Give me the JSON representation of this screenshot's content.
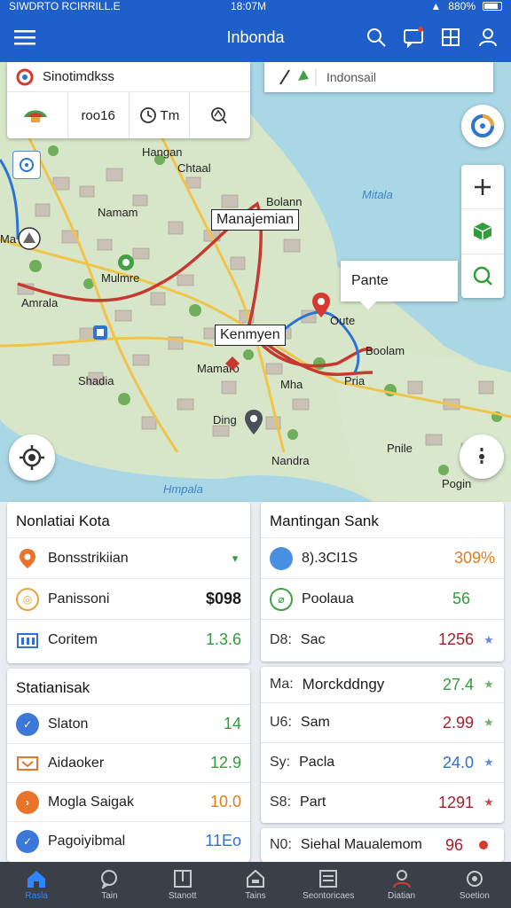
{
  "status_bar": {
    "left": "SIWDRTO RCIRRILL.E",
    "time": "18:07M",
    "battery": "880%"
  },
  "app_bar": {
    "title": "Inbonda"
  },
  "map": {
    "search": {
      "text": "Sinotimdkss",
      "chips": [
        "",
        "roo16",
        "Tm",
        ""
      ]
    },
    "destination": {
      "text": "Indonsail"
    },
    "labels": {
      "hangan": "Hangan",
      "chtaal": "Chtaal",
      "namam": "Namam",
      "mitala": "Mitala",
      "manajemian": "Manajemian",
      "bolann": "Bolann",
      "mulmre": "Mulmre",
      "amrala": "Amrala",
      "kenmyen": "Kenmyen",
      "oute": "Oute",
      "boolam": "Boolam",
      "shadia": "Shadia",
      "mamaro": "Mamaro",
      "mha": "Mha",
      "pria": "Pria",
      "ding": "Ding",
      "nandra": "Nandra",
      "pnile": "Pnile",
      "hmpala": "Hmpala",
      "pogin": "Pogin",
      "ma": "Ma"
    },
    "route_popup": "Pante"
  },
  "panels": {
    "left_top": {
      "title": "Nonlatiai Kota",
      "rows": [
        {
          "icon": "pin-icon",
          "color": "#e8732a",
          "label": "Bonsstrikiian",
          "value": "",
          "tail": "▾"
        },
        {
          "icon": "coin-icon",
          "color": "#e8a33b",
          "label": "Panissoni",
          "value": "$098",
          "tail": ""
        },
        {
          "icon": "building-icon",
          "color": "#2f6fd6",
          "label": "Coritem",
          "value": "1.3.6",
          "tail": ""
        }
      ]
    },
    "left_bottom": {
      "title": "Statianisak",
      "rows": [
        {
          "icon": "check-icon",
          "color": "#3b78d8",
          "label": "Slaton",
          "value": "14",
          "tail": ""
        },
        {
          "icon": "train-icon",
          "color": "#e8732a",
          "label": "Aidaoker",
          "value": "12.9",
          "tail": ""
        },
        {
          "icon": "chevron-icon",
          "color": "#e8732a",
          "label": "Mogla Saigak",
          "value": "10.0",
          "tail": ""
        },
        {
          "icon": "check-icon",
          "color": "#3b78d8",
          "label": "Pagoiyibmal",
          "value": "11Eo",
          "tail": ""
        }
      ]
    },
    "right_top": {
      "title": "Mantingan Sank",
      "rows": [
        {
          "prefix": "",
          "icon": "dot-icon",
          "color": "#4a90e2",
          "label": "8).3CI1S",
          "value": "309%",
          "tail": ""
        },
        {
          "prefix": "",
          "icon": "leaf-icon",
          "color": "#43a047",
          "label": "Poolaua",
          "value": "56",
          "tail": ""
        },
        {
          "prefix": "D8:",
          "icon": "",
          "color": "",
          "label": "Sac",
          "value": "1256",
          "tail": "★"
        }
      ]
    },
    "right_bottom": {
      "title": "Morckddngy",
      "title_prefix": "Ma:",
      "rows": [
        {
          "prefix": "",
          "label": "",
          "value": "27.4",
          "tail": "★"
        },
        {
          "prefix": "U6:",
          "label": "Sam",
          "value": "2.99",
          "tail": "★"
        },
        {
          "prefix": "Sy:",
          "label": "Pacla",
          "value": "24.0",
          "tail": "★"
        },
        {
          "prefix": "S8:",
          "label": "Part",
          "value": "1291",
          "tail": "★"
        }
      ]
    },
    "right_footer": {
      "prefix": "N0:",
      "label": "Siehal Maualemom",
      "value": "96"
    }
  },
  "bottom_nav": [
    {
      "label": "Rasla",
      "icon": "home-icon",
      "active": true
    },
    {
      "label": "Tain",
      "icon": "chat-icon",
      "active": false
    },
    {
      "label": "Stanott",
      "icon": "book-icon",
      "active": false
    },
    {
      "label": "Tains",
      "icon": "bag-icon",
      "active": false
    },
    {
      "label": "Seontoricaes",
      "icon": "list-icon",
      "active": false
    },
    {
      "label": "Diatian",
      "icon": "person-icon",
      "active": false
    },
    {
      "label": "Soetion",
      "icon": "settings-icon",
      "active": false
    }
  ],
  "colors": {
    "primary": "#1f5fc9",
    "green_value": "#2e9d3a",
    "red_value": "#a81e2b",
    "blue_value": "#2f6fd6",
    "orange_value": "#e07b1f"
  }
}
